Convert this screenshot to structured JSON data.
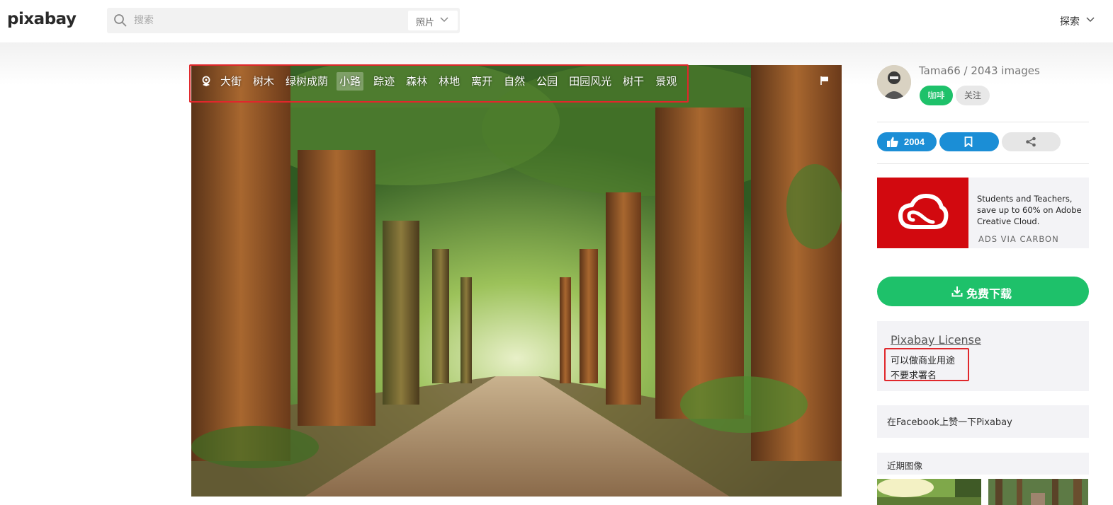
{
  "header": {
    "logo": "pixabay",
    "search_placeholder": "搜索",
    "media_type": "照片",
    "explore": "探索"
  },
  "photo": {
    "tags": [
      "大街",
      "树木",
      "绿树成荫",
      "小路",
      "踪迹",
      "森林",
      "林地",
      "离开",
      "自然",
      "公园",
      "田园风光",
      "树干",
      "景观"
    ],
    "active_tag": "小路"
  },
  "author": {
    "name_line": "Tama66 / 2043 images",
    "coffee_label": "咖啡",
    "follow_label": "关注"
  },
  "actions": {
    "likes": "2004"
  },
  "ad": {
    "text": "Students and Teachers, save up to 60% on Adobe Creative Cloud.",
    "via": "ADS VIA CARBON"
  },
  "download": {
    "label": "免费下载"
  },
  "license": {
    "title": "Pixabay License",
    "line1": "可以做商业用途",
    "line2": "不要求署名"
  },
  "facebook": {
    "text": "在Facebook上赞一下Pixabay"
  },
  "recent": {
    "title": "近期图像"
  },
  "colors": {
    "accent_green": "#1ec16a",
    "accent_blue": "#1b8ed6",
    "highlight_red": "#e0272b",
    "ad_red": "#d2090f"
  }
}
